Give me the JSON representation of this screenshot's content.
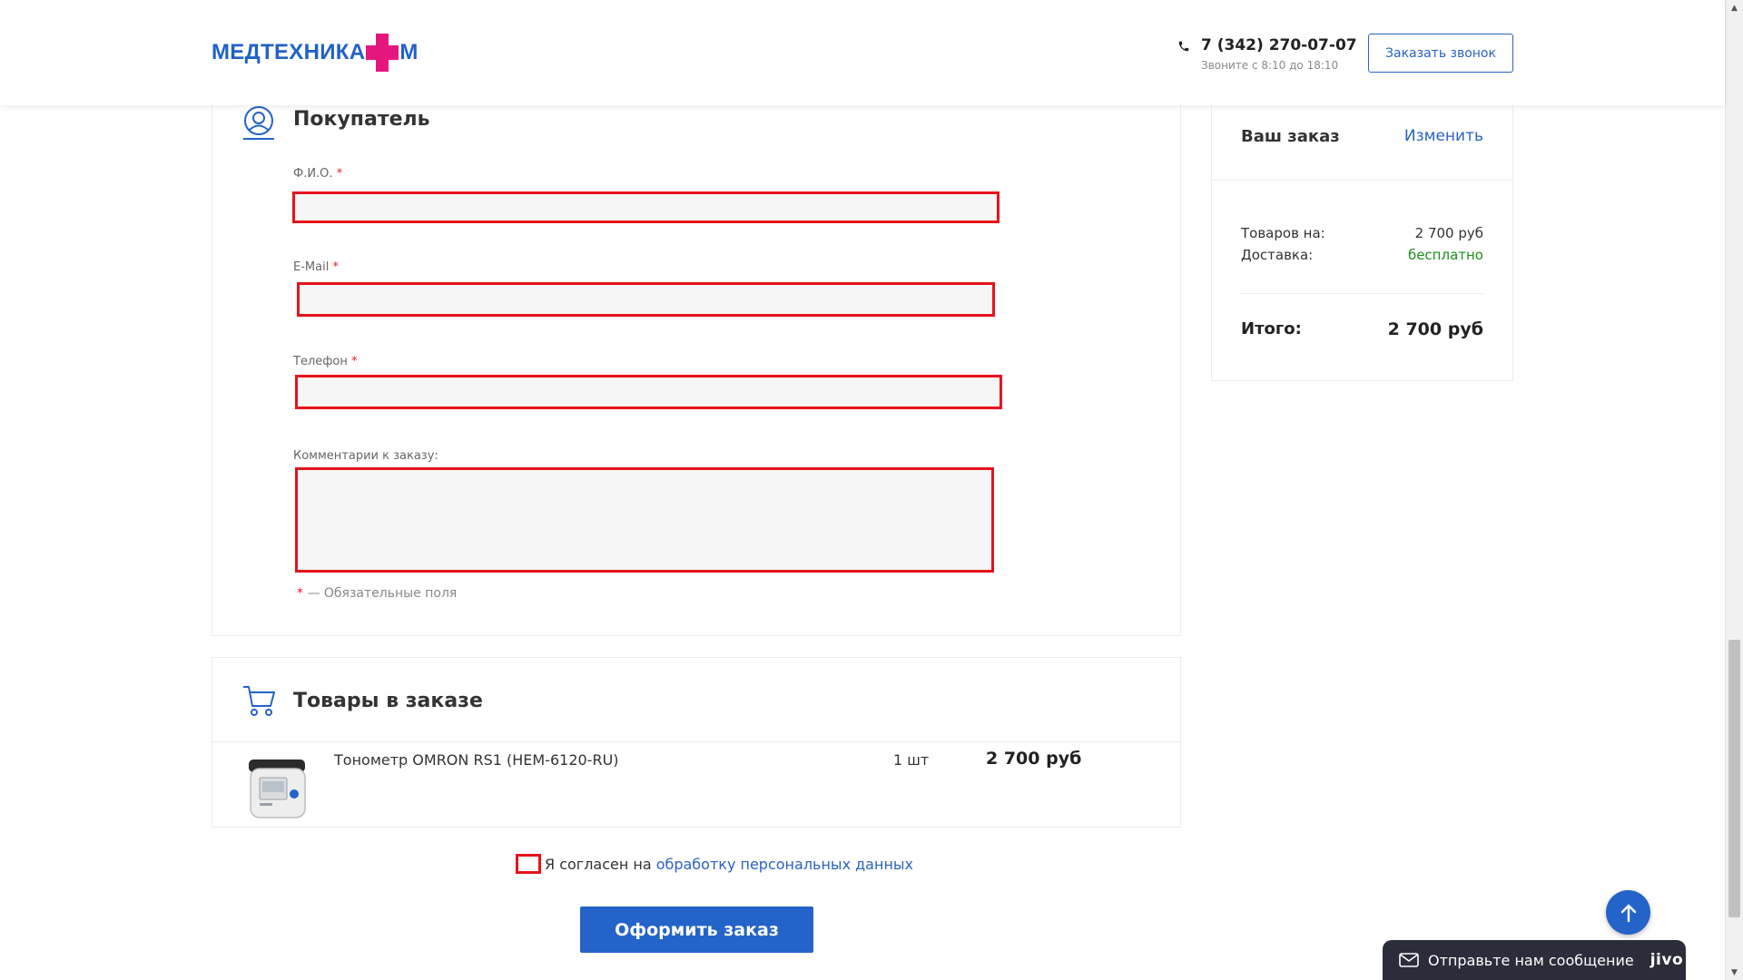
{
  "header": {
    "logo_text": "МЕДТЕХНИКА",
    "logo_suffix": "М",
    "phone": "7 (342) 270-07-07",
    "hours": "Звоните с 8:10 до 18:10",
    "callback_label": "Заказать звонок"
  },
  "buyer": {
    "title": "Покупатель",
    "fields": [
      {
        "label": "Ф.И.О.",
        "required": "*",
        "value": ""
      },
      {
        "label": "E-Mail",
        "required": "*",
        "value": ""
      },
      {
        "label": "Телефон",
        "required": "*",
        "value": ""
      },
      {
        "label": "Комментарии к заказу:",
        "value": ""
      }
    ],
    "required_mark": "*",
    "required_note": "— Обязательные поля"
  },
  "summary": {
    "title": "Ваш заказ",
    "change_label": "Изменить",
    "goods_label": "Товаров на:",
    "goods_value": "2 700 руб",
    "delivery_label": "Доставка:",
    "delivery_value": "бесплатно",
    "total_label": "Итого:",
    "total_value": "2 700 руб"
  },
  "goods": {
    "title": "Товары в заказе",
    "items": [
      {
        "name": "Тонометр OMRON RS1 (HEM-6120-RU)",
        "qty": "1 шт",
        "price": "2 700 руб"
      }
    ]
  },
  "consent": {
    "text": "Я согласен на",
    "link": "обработку персональных данных"
  },
  "submit_label": "Оформить заказ",
  "jivo": {
    "text": "Отправьте нам сообщение",
    "brand": "jivo"
  },
  "colors": {
    "accent_blue": "#2463c8",
    "logo_pink": "#e5177e",
    "error_red": "#e6131b",
    "free_green": "#1a8f1a"
  },
  "icons": [
    "phone-icon",
    "user-icon",
    "cart-icon",
    "arrow-up-icon",
    "mail-icon"
  ]
}
